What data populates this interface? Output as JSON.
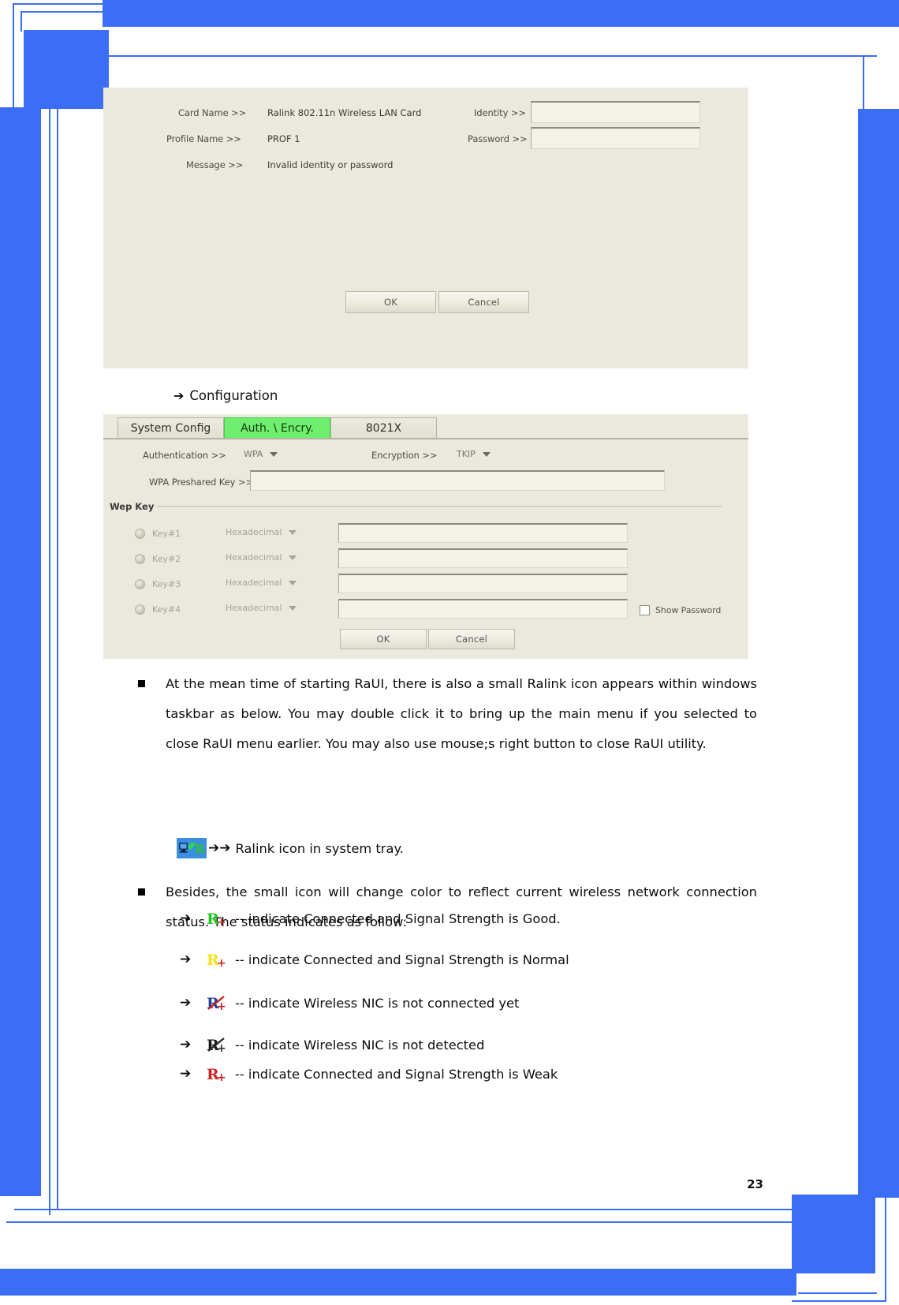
{
  "page": {
    "number": "23",
    "accent_blue": "#3b6ef5",
    "dialog_bg": "#ebe9dd",
    "active_tab_green": "#6ef06e"
  },
  "dialog_identity": {
    "name": "802.1x identity dialog",
    "card_name_label": "Card Name >>",
    "card_name_value": "Ralink 802.11n Wireless LAN Card",
    "profile_name_label": "Profile Name >>",
    "profile_name_value": "PROF 1",
    "message_label": "Message >>",
    "message_value": "Invalid identity or password",
    "identity_label": "Identity >>",
    "identity_value": "",
    "password_label": "Password >>",
    "password_value": "",
    "ok_label": "OK",
    "cancel_label": "Cancel"
  },
  "configuration_caption": {
    "arrow": "➔",
    "text": "Configuration"
  },
  "dialog_config": {
    "name": "profile configuration dialog",
    "tabs": [
      {
        "label": "System Config",
        "active": false
      },
      {
        "label": "Auth. \\ Encry.",
        "active": true
      },
      {
        "label": "8021X",
        "active": false
      }
    ],
    "authentication_label": "Authentication >>",
    "authentication_value": "WPA",
    "encryption_label": "Encryption >>",
    "encryption_value": "TKIP",
    "wpa_preshared_key_label": "WPA Preshared Key >>",
    "wpa_preshared_key_value": "",
    "wep_key_group_title": "Wep Key",
    "wep_keys": [
      {
        "label": "Key#1",
        "format": "Hexadecimal",
        "value": ""
      },
      {
        "label": "Key#2",
        "format": "Hexadecimal",
        "value": ""
      },
      {
        "label": "Key#3",
        "format": "Hexadecimal",
        "value": ""
      },
      {
        "label": "Key#4",
        "format": "Hexadecimal",
        "value": ""
      }
    ],
    "show_password_label": "Show Password",
    "show_password_checked": false,
    "ok_label": "OK",
    "cancel_label": "Cancel"
  },
  "body": {
    "bullet_1": "At the mean time of starting RaUI, there is also a small Ralink icon appears within windows taskbar as below. You may double click it to bring up the main menu if you selected to close RaUI menu earlier. You may also use mouse;s right button to close RaUI utility.",
    "tray_caption": {
      "arrows": "➔➔",
      "text": "Ralink icon in system tray."
    },
    "bullet_2": "Besides, the small icon will change color to reflect current wireless network connection status. The status indicates as follow:",
    "status_list": [
      {
        "arrow": "➔",
        "icon": "ralink-r-green-icon",
        "icon_color": "#22c522",
        "plus_color": "#cc2222",
        "text": "-- indicate Connected and Signal Strength is Good."
      },
      {
        "arrow": "➔",
        "icon": "ralink-r-yellow-icon",
        "icon_color": "#f5e016",
        "plus_color": "#cc2222",
        "text": "-- indicate Connected and Signal Strength is Normal"
      },
      {
        "arrow": "➔",
        "icon": "ralink-r-blue-crossed-icon",
        "icon_color": "#21409a",
        "plus_color": "#cc2222",
        "text": "-- indicate Wireless NIC is not connected yet"
      },
      {
        "arrow": "➔",
        "icon": "ralink-r-black-crossed-icon",
        "icon_color": "#1a1a1a",
        "plus_color": "#2b2b2b",
        "text": "-- indicate Wireless NIC is not detected"
      },
      {
        "arrow": "➔",
        "icon": "ralink-r-red-icon",
        "icon_color": "#cc2020",
        "plus_color": "#cc2222",
        "text": "-- indicate Connected and Signal Strength is Weak"
      }
    ]
  }
}
